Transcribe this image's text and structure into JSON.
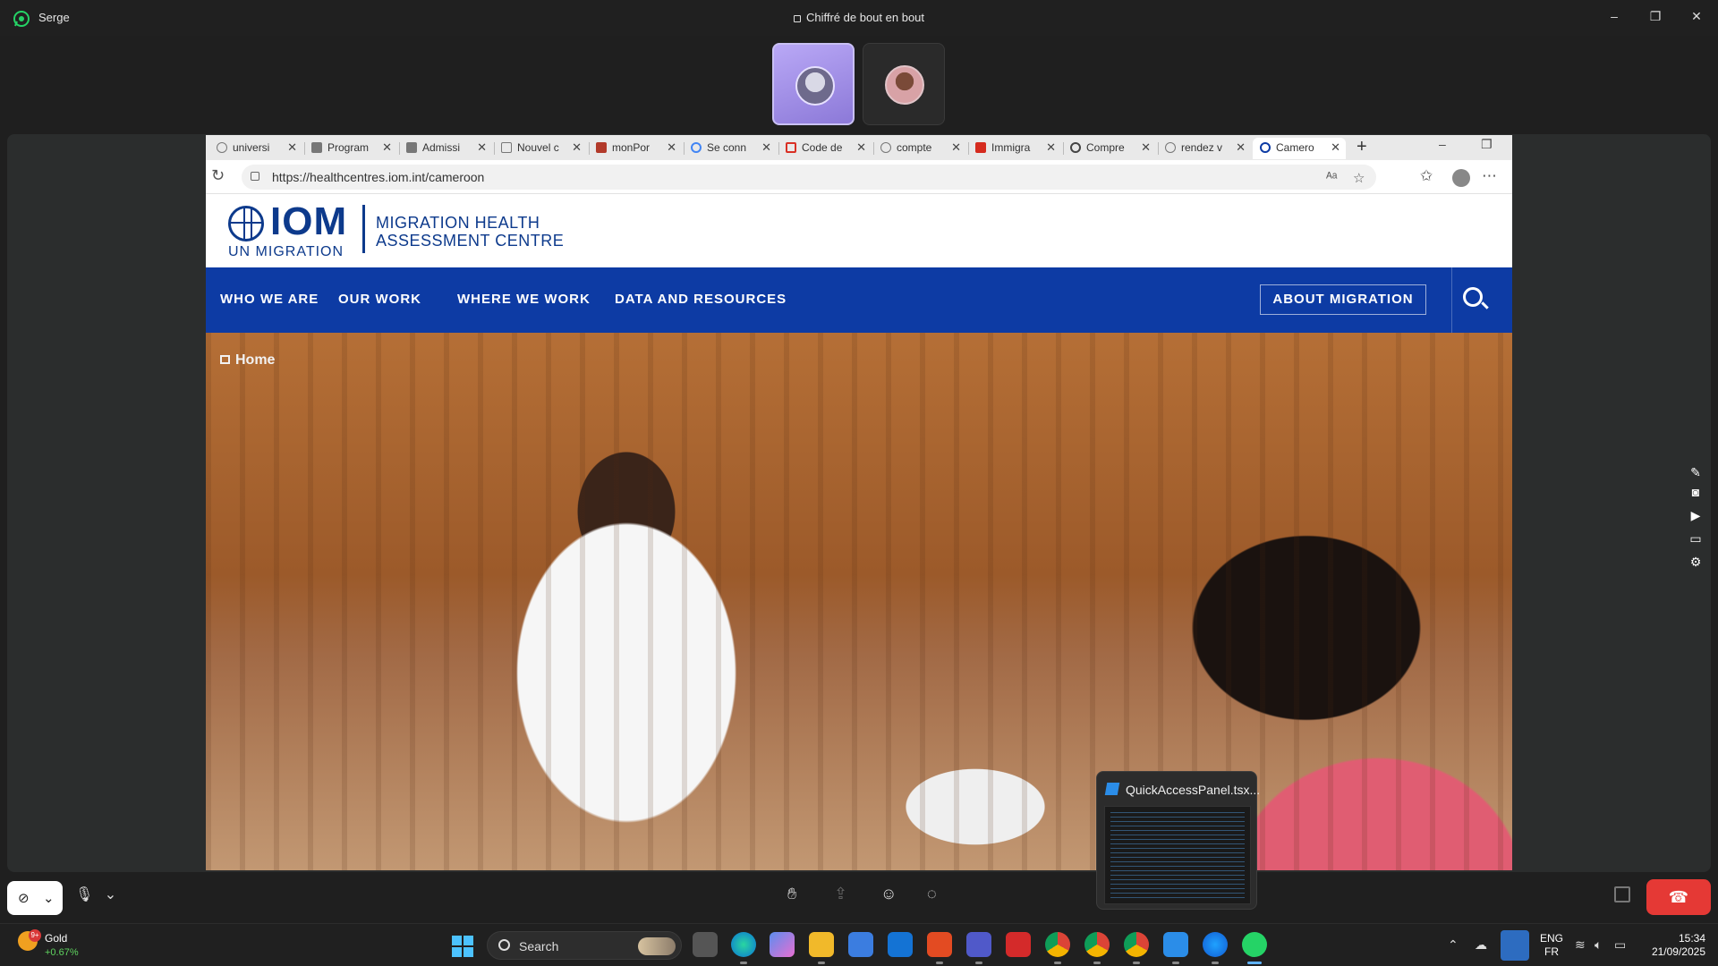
{
  "whatsapp": {
    "contact_name": "Serge",
    "encryption_label": "Chiffré de bout en bout",
    "accent_color": "#25D366"
  },
  "browser": {
    "tabs": [
      {
        "label": "universi",
        "icon": "search-icon"
      },
      {
        "label": "Program",
        "icon": "t-app-icon"
      },
      {
        "label": "Admissi",
        "icon": "t-app-icon"
      },
      {
        "label": "Nouvel c",
        "icon": "page-icon"
      },
      {
        "label": "monPor",
        "icon": "puzzle-icon"
      },
      {
        "label": "Se conn",
        "icon": "google-icon"
      },
      {
        "label": "Code de",
        "icon": "gmail-icon"
      },
      {
        "label": "compte",
        "icon": "search-icon"
      },
      {
        "label": "Immigra",
        "icon": "maple-leaf-icon"
      },
      {
        "label": "Compre",
        "icon": "openai-icon"
      },
      {
        "label": "rendez v",
        "icon": "search-icon"
      },
      {
        "label": "Camero",
        "icon": "iom-icon",
        "active": true
      }
    ],
    "url": "https://healthcentres.iom.int/cameroon"
  },
  "site": {
    "logo_main": "IOM",
    "logo_sub": "UN MIGRATION",
    "logo_title_line1": "MIGRATION HEALTH",
    "logo_title_line2": "ASSESSMENT CENTRE",
    "brand_color": "#0D3BA4",
    "nav": [
      "WHO WE ARE",
      "OUR WORK",
      "WHERE WE WORK",
      "DATA AND RESOURCES"
    ],
    "nav_about": "ABOUT MIGRATION",
    "breadcrumb": "Home"
  },
  "preview": {
    "title": "QuickAccessPanel.tsx..."
  },
  "taskbar": {
    "weather_name": "Gold",
    "weather_change": "+0.67%",
    "weather_badge": "9+",
    "search_label": "Search",
    "lang_line1": "ENG",
    "lang_line2": "FR",
    "time": "15:34",
    "date": "21/09/2025"
  }
}
